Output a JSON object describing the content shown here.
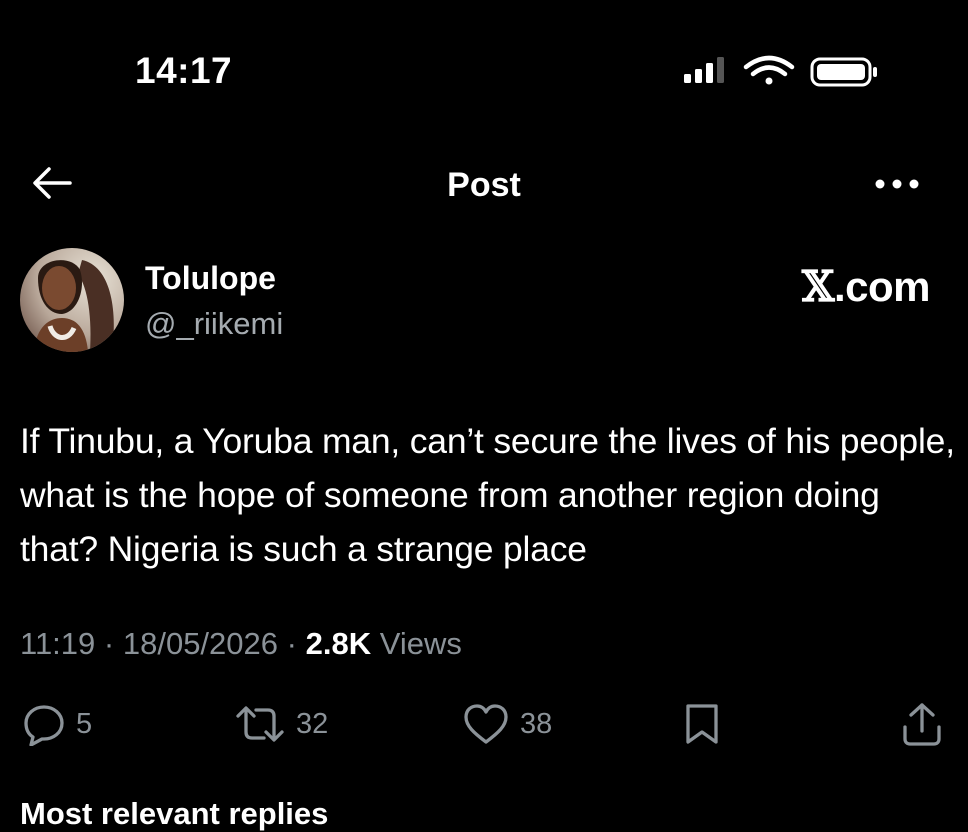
{
  "status_bar": {
    "time": "14:17",
    "icons": [
      "cellular-signal-icon",
      "wifi-icon",
      "battery-icon"
    ]
  },
  "nav": {
    "back_icon": "arrow-left-icon",
    "title": "Post",
    "more_icon": "more-horizontal-icon"
  },
  "post": {
    "author_name": "Tolulope",
    "author_handle": "@_riikemi",
    "watermark_glyph": "𝕏",
    "watermark_suffix": ".com",
    "text": "If Tinubu, a Yoruba man, can’t secure the lives of his people, what is the hope of someone from another region doing that? Nigeria is such a strange place",
    "time": "11:19",
    "separator": "·",
    "date": "18/05/2026",
    "views_count": "2.8K",
    "views_label": "Views"
  },
  "actions": {
    "reply_count": "5",
    "repost_count": "32",
    "like_count": "38",
    "bookmark_icon": "bookmark-icon",
    "share_icon": "share-icon"
  },
  "replies_header": "Most relevant replies",
  "colors": {
    "background": "#000000",
    "text_primary": "#ffffff",
    "text_secondary": "#8b9298"
  }
}
